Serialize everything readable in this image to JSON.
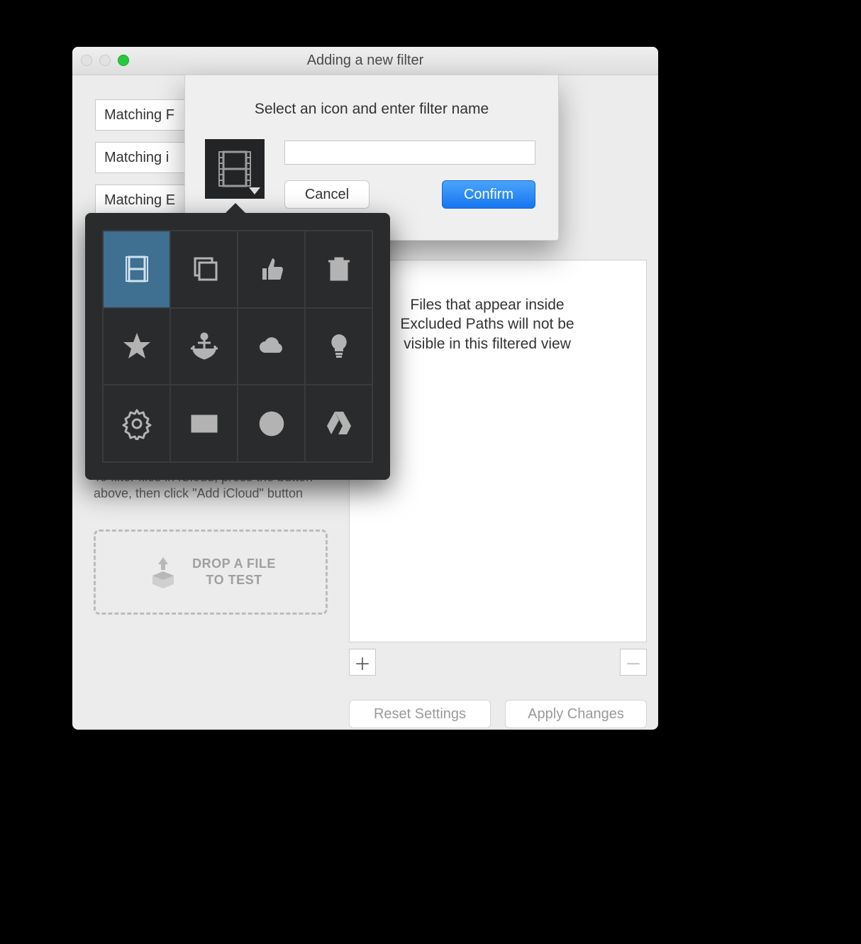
{
  "window": {
    "title": "Adding a new filter"
  },
  "left": {
    "btn1": "Matching F",
    "btn2": "Matching i",
    "btn3": "Matching E",
    "hint": "To filter files in iCloud, press the button above, then click \"Add iCloud\" button",
    "drop_line1": "DROP A FILE",
    "drop_line2": "TO TEST"
  },
  "right": {
    "info": "Files that appear inside Excluded Paths will not be visible in this filtered view"
  },
  "footer": {
    "plus": "＋",
    "minus": "－",
    "reset": "Reset Settings",
    "apply": "Apply Changes"
  },
  "dialog": {
    "prompt": "Select an icon and enter filter name",
    "name_value": "",
    "cancel": "Cancel",
    "confirm": "Confirm",
    "icons": [
      "film",
      "stack",
      "thumbs-up",
      "trash",
      "star",
      "anchor",
      "cloud",
      "bulb",
      "gear",
      "mail",
      "globe",
      "drive"
    ],
    "selected_icon": "film"
  }
}
